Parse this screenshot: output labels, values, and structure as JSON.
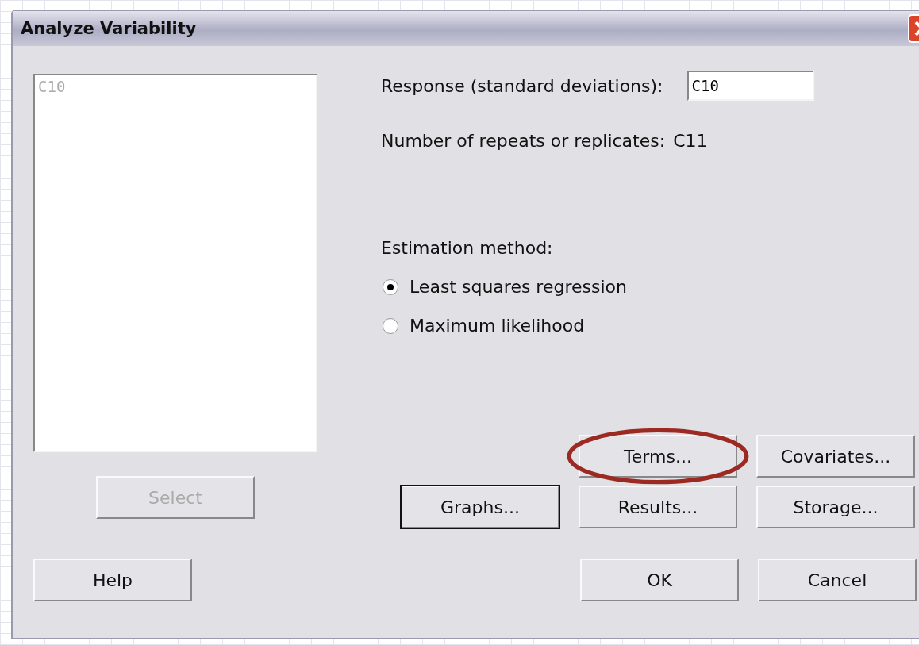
{
  "window": {
    "title": "Analyze Variability"
  },
  "variables_list": {
    "items": [
      "C10"
    ]
  },
  "select_button": {
    "label": "Select",
    "disabled": true
  },
  "response": {
    "label": "Response (standard deviations):",
    "value": "C10"
  },
  "repeats": {
    "label": "Number of repeats or replicates:",
    "value": "C11"
  },
  "estimation": {
    "label": "Estimation method:",
    "options": [
      {
        "label": "Least squares regression",
        "selected": true
      },
      {
        "label": "Maximum likelihood",
        "selected": false
      }
    ]
  },
  "option_buttons": [
    [
      {
        "label": "Terms...",
        "circled": true,
        "focused": false
      },
      {
        "label": "Covariates...",
        "circled": false,
        "focused": false
      }
    ],
    [
      {
        "label": "Graphs...",
        "circled": false,
        "focused": true
      },
      {
        "label": "Results...",
        "circled": false,
        "focused": false
      },
      {
        "label": "Storage...",
        "circled": false,
        "focused": false
      }
    ]
  ],
  "help_button": {
    "label": "Help"
  },
  "action_buttons": [
    {
      "label": "OK"
    },
    {
      "label": "Cancel"
    }
  ]
}
